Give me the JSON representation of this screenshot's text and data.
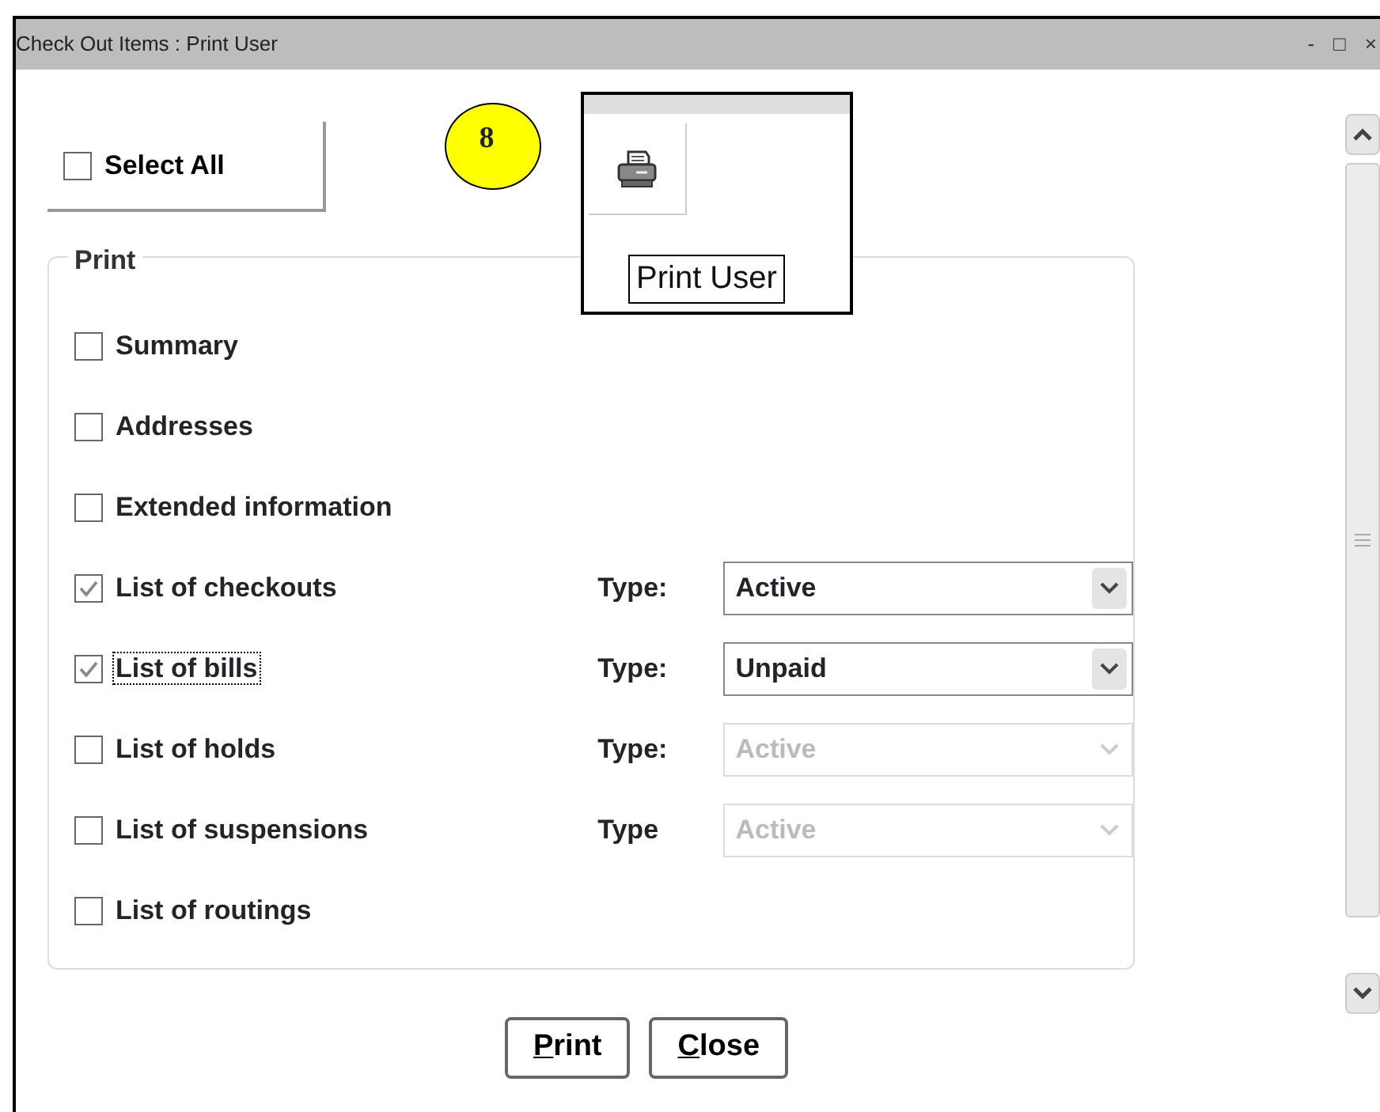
{
  "window": {
    "title": "Check Out Items : Print User",
    "controls": [
      "-",
      "□",
      "×"
    ]
  },
  "select_all": {
    "label": "Select All",
    "checked": false
  },
  "callout": {
    "number": "8"
  },
  "inset": {
    "tooltip": "Print User"
  },
  "print_group": {
    "legend": "Print",
    "options": [
      {
        "kind": "check",
        "label": "Summary",
        "checked": false,
        "focused": false
      },
      {
        "kind": "check",
        "label": "Addresses",
        "checked": false,
        "focused": false
      },
      {
        "kind": "check",
        "label": "Extended information",
        "checked": false,
        "focused": false
      },
      {
        "kind": "typed",
        "label": "List of checkouts",
        "checked": true,
        "focused": false,
        "type_label": "Type:",
        "type_value": "Active",
        "disabled": false
      },
      {
        "kind": "typed",
        "label": "List of bills",
        "checked": true,
        "focused": true,
        "type_label": "Type:",
        "type_value": "Unpaid",
        "disabled": false
      },
      {
        "kind": "typed",
        "label": "List of holds",
        "checked": false,
        "focused": false,
        "type_label": "Type:",
        "type_value": "Active",
        "disabled": true
      },
      {
        "kind": "typed",
        "label": "List of suspensions",
        "checked": false,
        "focused": false,
        "type_label": "Type",
        "type_value": "Active",
        "disabled": true
      },
      {
        "kind": "check",
        "label": "List of routings",
        "checked": false,
        "focused": false
      }
    ]
  },
  "buttons": [
    {
      "label": "Print",
      "underline_first": true
    },
    {
      "label": "Close",
      "underline_first": true
    }
  ]
}
